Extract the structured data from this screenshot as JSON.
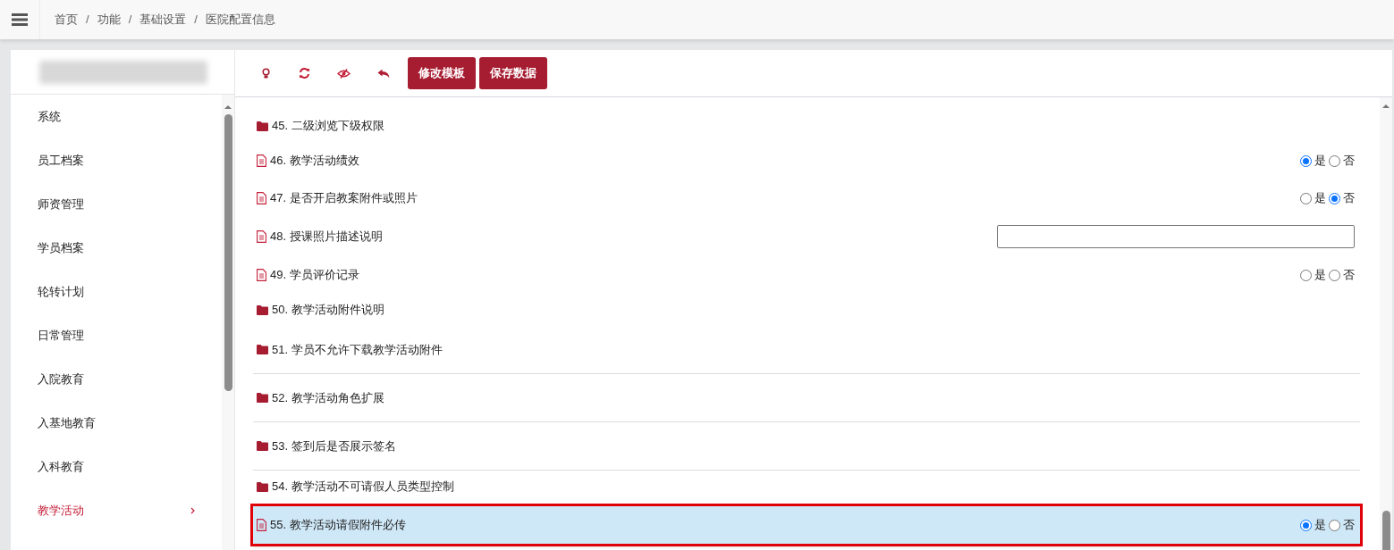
{
  "breadcrumb": {
    "separator": "/",
    "items": [
      "首页",
      "功能",
      "基础设置",
      "医院配置信息"
    ]
  },
  "sidebar": {
    "items": [
      {
        "label": "系统",
        "selected": false
      },
      {
        "label": "员工档案",
        "selected": false
      },
      {
        "label": "师资管理",
        "selected": false
      },
      {
        "label": "学员档案",
        "selected": false
      },
      {
        "label": "轮转计划",
        "selected": false
      },
      {
        "label": "日常管理",
        "selected": false
      },
      {
        "label": "入院教育",
        "selected": false
      },
      {
        "label": "入基地教育",
        "selected": false
      },
      {
        "label": "入科教育",
        "selected": false
      },
      {
        "label": "教学活动",
        "selected": true
      }
    ]
  },
  "toolbar": {
    "buttons": [
      "修改模板",
      "保存数据"
    ]
  },
  "settings": [
    {
      "kind": "folder",
      "label": "45. 二级浏览下级权限",
      "separated": false,
      "highlighted": false
    },
    {
      "kind": "file-radio",
      "label": "46. 教学活动绩效",
      "separated": false,
      "highlighted": false,
      "options": [
        {
          "label": "是",
          "selected": true
        },
        {
          "label": "否",
          "selected": false
        }
      ]
    },
    {
      "kind": "file-radio",
      "label": "47. 是否开启教案附件或照片",
      "separated": false,
      "highlighted": false,
      "options": [
        {
          "label": "是",
          "selected": false
        },
        {
          "label": "否",
          "selected": true
        }
      ]
    },
    {
      "kind": "file-text",
      "label": "48. 授课照片描述说明",
      "separated": false,
      "highlighted": false
    },
    {
      "kind": "file-radio",
      "label": "49. 学员评价记录",
      "separated": false,
      "highlighted": false,
      "options": [
        {
          "label": "是",
          "selected": false
        },
        {
          "label": "否",
          "selected": false
        }
      ]
    },
    {
      "kind": "folder",
      "label": "50. 教学活动附件说明",
      "separated": false,
      "highlighted": false
    },
    {
      "kind": "folder",
      "label": "51. 学员不允许下载教学活动附件",
      "separated": true,
      "highlighted": false
    },
    {
      "kind": "folder",
      "label": "52. 教学活动角色扩展",
      "separated": true,
      "highlighted": false
    },
    {
      "kind": "folder",
      "label": "53. 签到后是否展示签名",
      "separated": true,
      "highlighted": false
    },
    {
      "kind": "folder",
      "label": "54. 教学活动不可请假人员类型控制",
      "separated": false,
      "highlighted": false
    },
    {
      "kind": "file-radio",
      "label": "55. 教学活动请假附件必传",
      "separated": false,
      "highlighted": true,
      "options": [
        {
          "label": "是",
          "selected": true
        },
        {
          "label": "否",
          "selected": false
        }
      ]
    }
  ]
}
